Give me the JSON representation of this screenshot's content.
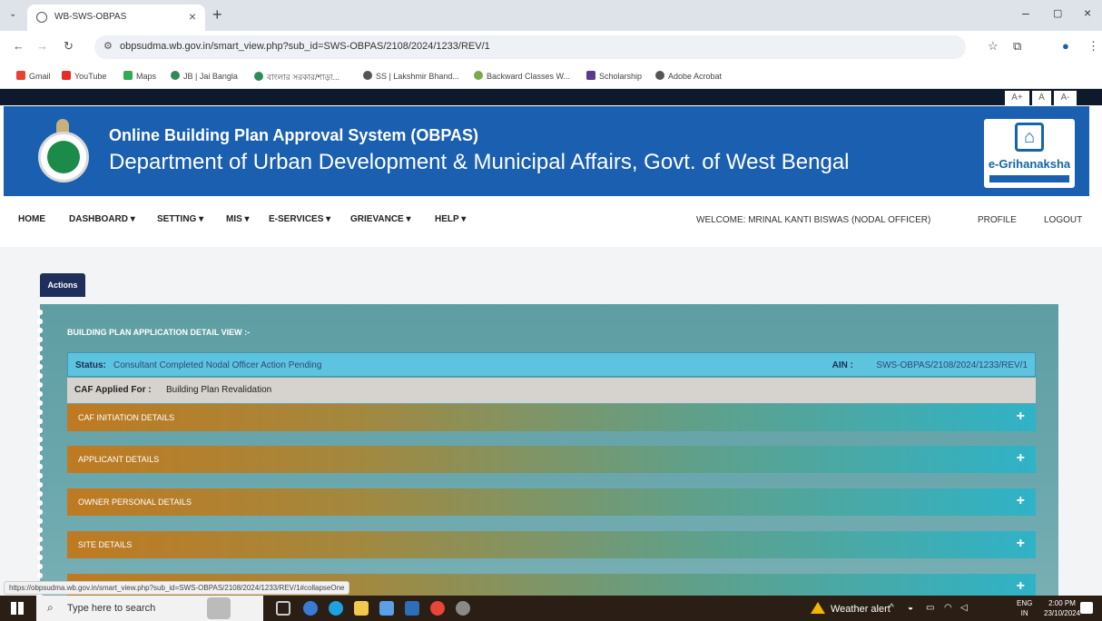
{
  "browser": {
    "tab_title": "WB-SWS-OBPAS",
    "url": "obpsudma.wb.gov.in/smart_view.php?sub_id=SWS-OBPAS/2108/2024/1233/REV/1",
    "bookmarks": [
      "Gmail",
      "YouTube",
      "Maps",
      "JB | Jai Bangla",
      "বাংলার সরকার/শাড়া...",
      "SS | Lakshmir Bhand...",
      "Backward Classes W...",
      "Scholarship",
      "Adobe Acrobat"
    ],
    "status_url": "https://obpsudma.wb.gov.in/smart_view.php?sub_id=SWS-OBPAS/2108/2024/1233/REV/1#collapseOne"
  },
  "font_controls": [
    "A+",
    "A",
    "A-"
  ],
  "header": {
    "title_line1": "Online Building Plan Approval System (OBPAS)",
    "title_line2": "Department of Urban Development & Municipal Affairs, Govt. of West Bengal",
    "brand": "e-Grihanaksha"
  },
  "nav": {
    "items": [
      "HOME",
      "DASHBOARD ▾",
      "SETTING ▾",
      "MIS ▾",
      "E-SERVICES ▾",
      "GRIEVANCE ▾",
      "HELP ▾"
    ],
    "welcome": "WELCOME: MRINAL KANTI BISWAS (NODAL OFFICER)",
    "profile": "PROFILE",
    "logout": "LOGOUT"
  },
  "actions_label": "Actions",
  "detail": {
    "heading": "BUILDING PLAN APPLICATION DETAIL VIEW :-",
    "status_label": "Status:",
    "status_value": "Consultant Completed Nodal Officer Action Pending",
    "ain_label": "AIN :",
    "ain_value": "SWS-OBPAS/2108/2024/1233/REV/1",
    "caf_label": "CAF Applied For :",
    "caf_value": "Building Plan Revalidation",
    "sections": [
      "CAF INITIATION DETAILS",
      "APPLICANT DETAILS",
      "OWNER PERSONAL DETAILS",
      "SITE DETAILS",
      ""
    ],
    "expand_symbol": "+"
  },
  "taskbar": {
    "search_placeholder": "Type here to search",
    "weather": "Weather alert",
    "lang_top": "ENG",
    "lang_bottom": "IN",
    "time": "2:00 PM",
    "date": "23/10/2024"
  },
  "colors": {
    "header_blue": "#1a5fb0",
    "panel_teal": "#6aa7ad",
    "status_cyan": "#5dc4df",
    "accordion_orange": "#bf7a22",
    "accordion_teal": "#2fb3c7"
  }
}
